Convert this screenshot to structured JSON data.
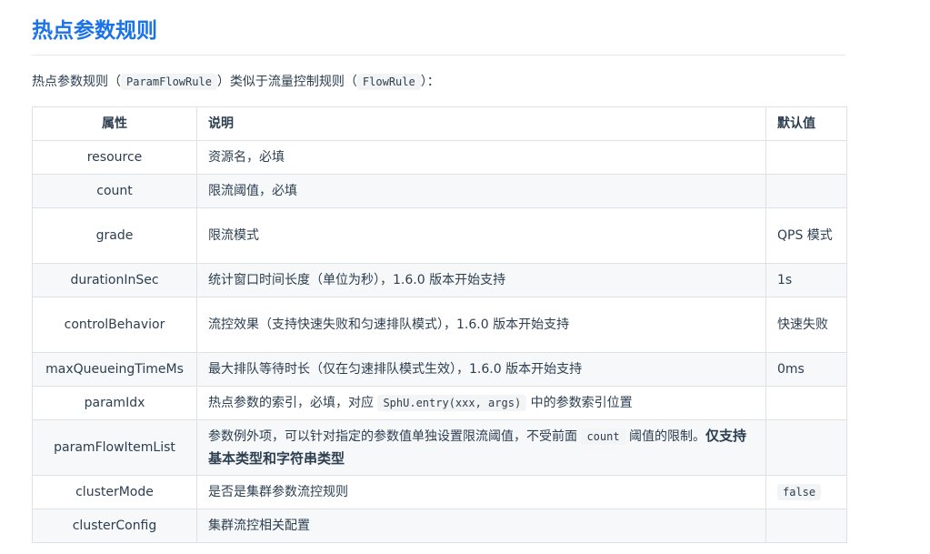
{
  "title": "热点参数规则",
  "intro": {
    "prefix": "热点参数规则（",
    "code1": "ParamFlowRule",
    "middle": "）类似于流量控制规则（",
    "code2": "FlowRule",
    "suffix": "）："
  },
  "table": {
    "headers": [
      "属性",
      "说明",
      "默认值"
    ],
    "rows": [
      {
        "name": "resource",
        "desc": "资源名，必填",
        "default": ""
      },
      {
        "name": "count",
        "desc": "限流阈值，必填",
        "default": ""
      },
      {
        "name": "grade",
        "desc": "限流模式",
        "default": "QPS 模式"
      },
      {
        "name": "durationInSec",
        "desc": "统计窗口时间长度（单位为秒），1.6.0 版本开始支持",
        "default": "1s"
      },
      {
        "name": "controlBehavior",
        "desc": "流控效果（支持快速失败和匀速排队模式），1.6.0 版本开始支持",
        "default": "快速失败"
      },
      {
        "name": "maxQueueingTimeMs",
        "desc": "最大排队等待时长（仅在匀速排队模式生效），1.6.0 版本开始支持",
        "default": "0ms"
      },
      {
        "name": "paramIdx",
        "desc_prefix": "热点参数的索引，必填，对应",
        "desc_code": "SphU.entry(xxx, args)",
        "desc_suffix": "中的参数索引位置",
        "default": ""
      },
      {
        "name": "paramFlowItemList",
        "desc_prefix": "参数例外项，可以针对指定的参数值单独设置限流阈值，不受前面",
        "desc_code": "count",
        "desc_suffix": "阈值的限制。",
        "desc_bold": "仅支持基本类型和字符串类型",
        "default": ""
      },
      {
        "name": "clusterMode",
        "desc": "是否是集群参数流控规则",
        "default_code": "false"
      },
      {
        "name": "clusterConfig",
        "desc": "集群流控相关配置",
        "default": ""
      }
    ]
  }
}
